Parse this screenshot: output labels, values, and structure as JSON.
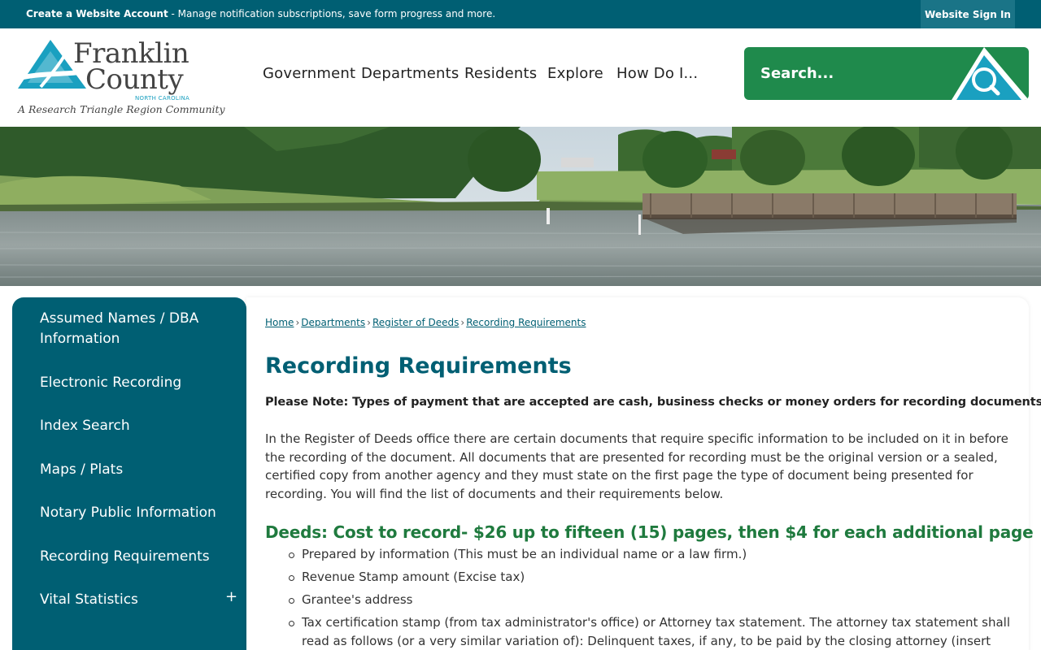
{
  "topbar": {
    "account_bold": "Create a Website Account",
    "account_text": " - Manage notification subscriptions, save form progress and more.",
    "signin_label": "Website Sign In"
  },
  "logo": {
    "name_line1": "Franklin",
    "name_line2": "County",
    "state": "NORTH CAROLINA",
    "tagline": "A Research Triangle Region Community"
  },
  "nav": {
    "items": [
      "Government",
      "Departments",
      "Residents",
      "Explore",
      "How Do I..."
    ]
  },
  "search": {
    "placeholder": "Search..."
  },
  "sidebar": {
    "items": [
      "Assumed Names / DBA Information",
      "Electronic Recording",
      "Index Search",
      "Maps / Plats",
      "Notary Public Information",
      "Recording Requirements",
      "Vital Statistics"
    ],
    "expand_symbol": "+"
  },
  "breadcrumb": {
    "items": [
      "Home",
      "Departments",
      "Register of Deeds",
      "Recording Requirements"
    ],
    "separator": "›"
  },
  "page": {
    "title": "Recording Requirements",
    "note": "Please Note: Types of payment that are accepted are cash, business checks or money orders for recording documents!",
    "intro": "In the Register of Deeds office there are certain documents that require specific information to be included on it in before the recording of the document. All documents that are presented for recording must be the original version or a sealed, certified copy from another agency and they must state on the first page the type of document being presented for recording. You will find the list of documents and their requirements below.",
    "deeds_heading": "Deeds: Cost to record- $26 up to fifteen (15) pages, then $4 for each additional page",
    "deeds_requirements": [
      "Prepared by information (This must be an individual name or a law firm.)",
      "Revenue Stamp amount (Excise tax)",
      "Grantee's address",
      "Tax certification stamp (from tax administrator's office) or Attorney tax statement. The attorney tax statement shall read as follows (or a very similar variation of): Delinquent taxes, if any, to be paid by the closing attorney (insert attorney's name),"
    ]
  },
  "colors": {
    "brand_teal": "#005f73",
    "search_green": "#1f8a4c",
    "heading_green": "#1f7a3e"
  }
}
